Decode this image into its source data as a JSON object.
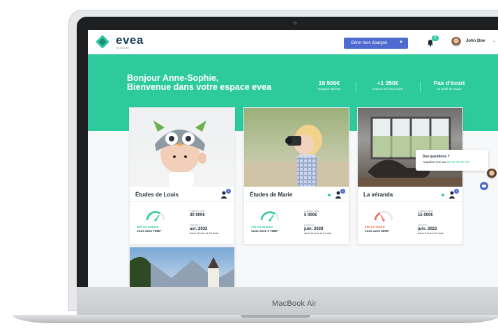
{
  "device": {
    "brand": "MacBook Air"
  },
  "header": {
    "logo": "evea",
    "logo_sub": "by inCube",
    "cta_label": "Gérer mon épargne",
    "notif_count": "3",
    "user_name": "John Doe"
  },
  "hero": {
    "greeting_line1": "Bonjour Anne-Sophie,",
    "greeting_line2": "Bienvenue dans votre espace evea",
    "stats": [
      {
        "value": "18 500€",
        "label": "épargne atteinte"
      },
      {
        "value": "+1 350€",
        "label": "avance sur les projets"
      },
      {
        "value": "Pas d'écart",
        "label": "au profil de risque"
      }
    ]
  },
  "projects": [
    {
      "title": "Études de Louis",
      "badge": "2",
      "delta": "40€ en avance",
      "having": "vous avez 708€*",
      "target_label": "Capital cible",
      "target_value": "30 000€",
      "horizon_label": "Horizon",
      "horizon_value": "avr. 2032",
      "horizon_sub": "dans 15 ans et 10 mois",
      "status_color": "#2dca9d",
      "gauge_level": 0.55
    },
    {
      "title": "Études de Marie",
      "badge": "2",
      "delta": "70€ en avance",
      "having": "vous avez 1 708€*",
      "target_label": "Capital cible",
      "target_value": "5 000€",
      "horizon_label": "Horizon",
      "horizon_value": "juin. 2028",
      "horizon_sub": "dans 11 ans et 0 mois",
      "status_color": "#2dca9d",
      "gauge_level": 0.6
    },
    {
      "title": "La véranda",
      "badge": "2",
      "delta": "25€ en retard",
      "having": "vous avez 500€*",
      "target_label": "Capital cible",
      "target_value": "15 000€",
      "horizon_label": "Horizon",
      "horizon_value": "juin. 2023",
      "horizon_sub": "dans 5 ans et 2 mois",
      "status_color": "#ee6b57",
      "gauge_level": 0.3
    }
  ],
  "chat": {
    "question": "Des questions ?",
    "call_prefix": "Appelez-moi au",
    "phone": "01 00 00 00 00"
  }
}
